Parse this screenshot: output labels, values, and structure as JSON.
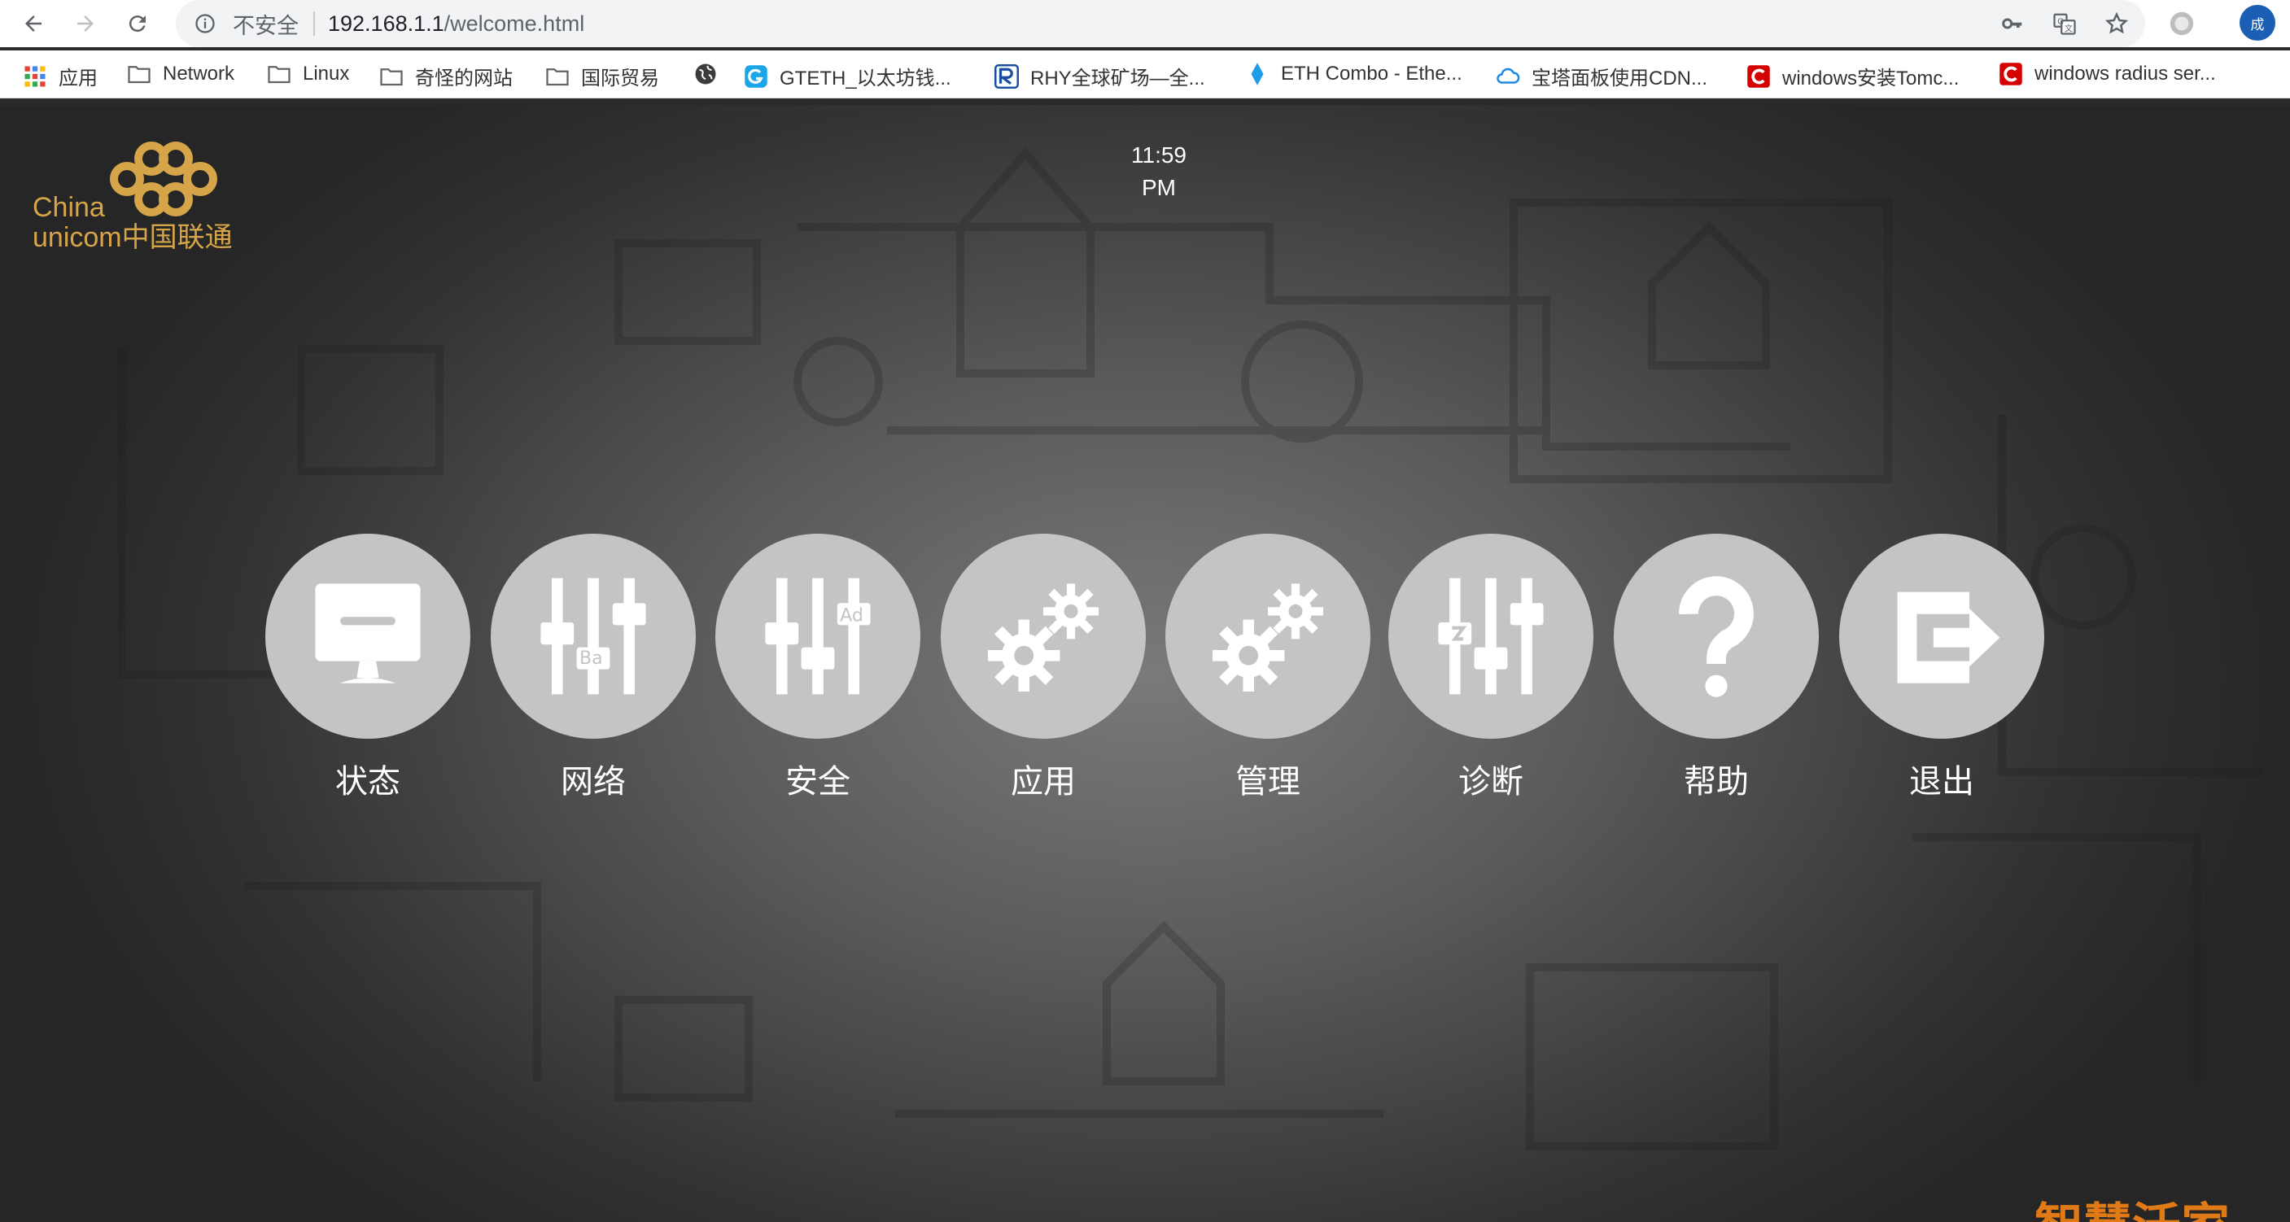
{
  "browser": {
    "nav": {
      "back_icon": "arrow-left-icon",
      "forward_icon": "arrow-right-icon",
      "reload_icon": "reload-icon"
    },
    "address_bar": {
      "security_label": "不安全",
      "host": "192.168.1.1",
      "path": "/welcome.html"
    },
    "right_icons": [
      "key-icon",
      "translate-icon",
      "star-icon"
    ],
    "profile_initial": "成"
  },
  "bookmarks": [
    {
      "label": "应用",
      "icon": "apps-grid-icon"
    },
    {
      "label": "Network",
      "icon": "folder-icon"
    },
    {
      "label": "Linux",
      "icon": "folder-icon"
    },
    {
      "label": "奇怪的网站",
      "icon": "folder-icon"
    },
    {
      "label": "国际贸易",
      "icon": "folder-icon"
    },
    {
      "label": "",
      "icon": "globe-icon"
    },
    {
      "label": "GTETH_以太坊钱...",
      "icon": "g-logo-icon"
    },
    {
      "label": "RHY全球矿场—全...",
      "icon": "rhy-logo-icon"
    },
    {
      "label": "ETH Combo - Ethe...",
      "icon": "ethereum-icon"
    },
    {
      "label": "宝塔面板使用CDN...",
      "icon": "cloud-icon"
    },
    {
      "label": "windows安装Tomc...",
      "icon": "csdn-logo-icon"
    },
    {
      "label": "windows radius ser...",
      "icon": "csdn-logo-icon"
    }
  ],
  "page": {
    "logo": {
      "line1": "China",
      "line2": "unicom中国联通"
    },
    "clock": {
      "time": "11:59",
      "meridiem": "PM"
    },
    "menu": [
      {
        "label": "状态",
        "icon": "monitor-icon"
      },
      {
        "label": "网络",
        "icon": "sliders-basic-icon"
      },
      {
        "label": "安全",
        "icon": "sliders-advanced-icon"
      },
      {
        "label": "应用",
        "icon": "gears-icon"
      },
      {
        "label": "管理",
        "icon": "gears-icon"
      },
      {
        "label": "诊断",
        "icon": "sliders-diagnose-icon"
      },
      {
        "label": "帮助",
        "icon": "question-icon"
      },
      {
        "label": "退出",
        "icon": "exit-icon"
      }
    ],
    "corner_text": "智慧沃家"
  },
  "colors": {
    "accent_gold": "#d6a54a",
    "circle": "#c4c4c4",
    "brand_orange": "#e07a16"
  }
}
